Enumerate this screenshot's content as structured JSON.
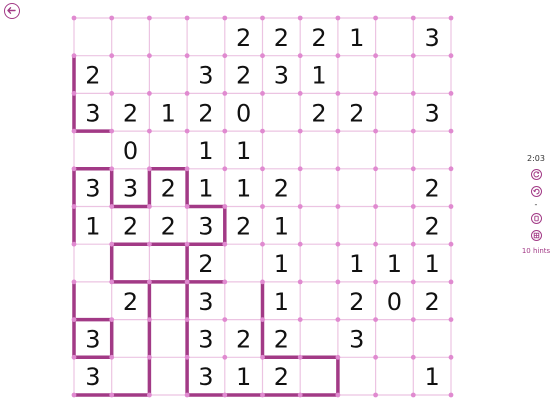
{
  "colors": {
    "grid_line": "#ecc4e2",
    "dot": "#e08ad0",
    "drawn_line": "#a23a86",
    "clue_text": "#111111"
  },
  "header": {
    "back_icon": "back-arrow-icon"
  },
  "sidebar": {
    "timer": "2:03",
    "icons": [
      "refresh-icon",
      "undo-icon"
    ],
    "separator": "-",
    "lower_icons": [
      "hint-icon",
      "check-icon"
    ],
    "hints_label": "10 hints"
  },
  "puzzle": {
    "rows": 10,
    "cols": 10,
    "clues": [
      [
        "",
        "",
        "",
        "",
        "2",
        "2",
        "2",
        "1",
        "",
        "3"
      ],
      [
        "2",
        "",
        "",
        "3",
        "2",
        "3",
        "1",
        "",
        "",
        ""
      ],
      [
        "3",
        "2",
        "1",
        "2",
        "0",
        "",
        "2",
        "2",
        "",
        "3"
      ],
      [
        "",
        "0",
        "",
        "1",
        "1",
        "",
        "",
        "",
        "",
        ""
      ],
      [
        "3",
        "3",
        "2",
        "1",
        "1",
        "2",
        "",
        "",
        "",
        "2"
      ],
      [
        "1",
        "2",
        "2",
        "3",
        "2",
        "1",
        "",
        "",
        "",
        "2"
      ],
      [
        "",
        "",
        "",
        "2",
        "",
        "1",
        "",
        "1",
        "1",
        "1"
      ],
      [
        "",
        "2",
        "",
        "3",
        "",
        "1",
        "",
        "2",
        "0",
        "2"
      ],
      [
        "3",
        "",
        "",
        "3",
        "2",
        "2",
        "",
        "3",
        "",
        ""
      ],
      [
        "3",
        "",
        "",
        "3",
        "1",
        "2",
        "",
        "",
        "",
        "1"
      ]
    ],
    "drawn_segments": [
      [
        [
          0,
          1
        ],
        [
          0,
          3
        ]
      ],
      [
        [
          0,
          3
        ],
        [
          1,
          3
        ]
      ],
      [
        [
          0,
          4
        ],
        [
          0,
          6
        ]
      ],
      [
        [
          0,
          4
        ],
        [
          1,
          4
        ]
      ],
      [
        [
          1,
          5
        ],
        [
          2,
          5
        ]
      ],
      [
        [
          2,
          5
        ],
        [
          2,
          4
        ]
      ],
      [
        [
          2,
          4
        ],
        [
          3,
          4
        ]
      ],
      [
        [
          3,
          4
        ],
        [
          3,
          5
        ]
      ],
      [
        [
          1,
          5
        ],
        [
          1,
          4
        ]
      ],
      [
        [
          3,
          5
        ],
        [
          4,
          5
        ]
      ],
      [
        [
          4,
          5
        ],
        [
          4,
          6
        ]
      ],
      [
        [
          1,
          6
        ],
        [
          4,
          6
        ]
      ],
      [
        [
          1,
          6
        ],
        [
          1,
          7
        ]
      ],
      [
        [
          1,
          7
        ],
        [
          3,
          7
        ]
      ],
      [
        [
          3,
          7
        ],
        [
          3,
          6
        ]
      ],
      [
        [
          3,
          6
        ],
        [
          4,
          6
        ]
      ],
      [
        [
          0,
          7
        ],
        [
          0,
          9
        ]
      ],
      [
        [
          0,
          8
        ],
        [
          1,
          8
        ]
      ],
      [
        [
          1,
          8
        ],
        [
          1,
          9
        ]
      ],
      [
        [
          0,
          9
        ],
        [
          1,
          9
        ]
      ],
      [
        [
          0,
          10
        ],
        [
          2,
          10
        ]
      ],
      [
        [
          2,
          9
        ],
        [
          2,
          10
        ]
      ],
      [
        [
          3,
          9
        ],
        [
          3,
          10
        ]
      ],
      [
        [
          3,
          10
        ],
        [
          7,
          10
        ]
      ],
      [
        [
          3,
          9
        ],
        [
          3,
          7
        ]
      ],
      [
        [
          3,
          7
        ],
        [
          4,
          7
        ]
      ],
      [
        [
          2,
          9
        ],
        [
          2,
          7
        ]
      ],
      [
        [
          5,
          7
        ],
        [
          5,
          9
        ]
      ],
      [
        [
          5,
          9
        ],
        [
          7,
          9
        ]
      ],
      [
        [
          7,
          9
        ],
        [
          7,
          10
        ]
      ]
    ]
  }
}
